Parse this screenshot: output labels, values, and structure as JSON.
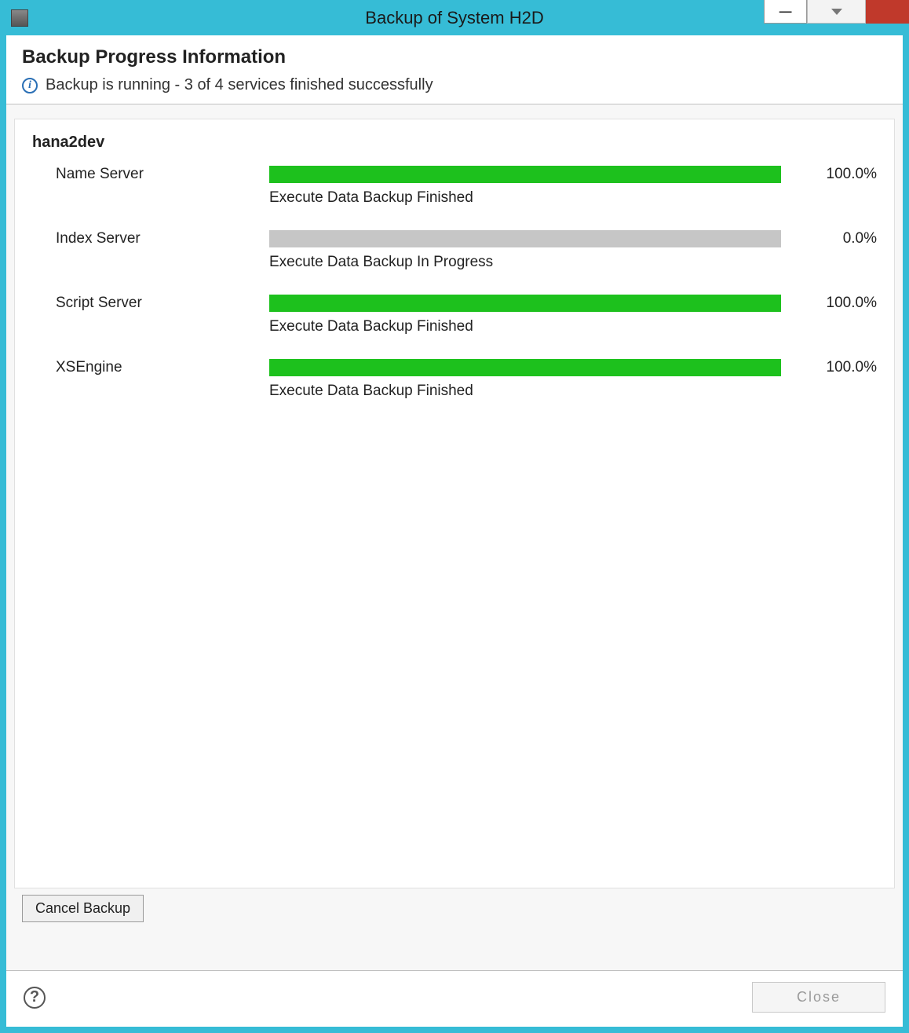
{
  "window": {
    "title": "Backup of System H2D"
  },
  "header": {
    "title": "Backup Progress Information",
    "status_text": "Backup is running - 3 of 4 services finished successfully"
  },
  "host": {
    "name": "hana2dev"
  },
  "services": [
    {
      "name": "Name Server",
      "progress_pct": 100.0,
      "percent_label": "100.0%",
      "status": "Execute Data Backup Finished",
      "color": "#1dc11d"
    },
    {
      "name": "Index Server",
      "progress_pct": 0.0,
      "percent_label": "0.0%",
      "status": "Execute Data Backup In Progress",
      "color": "#1dc11d"
    },
    {
      "name": "Script Server",
      "progress_pct": 100.0,
      "percent_label": "100.0%",
      "status": "Execute Data Backup Finished",
      "color": "#1dc11d"
    },
    {
      "name": "XSEngine",
      "progress_pct": 100.0,
      "percent_label": "100.0%",
      "status": "Execute Data Backup Finished",
      "color": "#1dc11d"
    }
  ],
  "buttons": {
    "cancel_label": "Cancel Backup",
    "close_label": "Close"
  }
}
